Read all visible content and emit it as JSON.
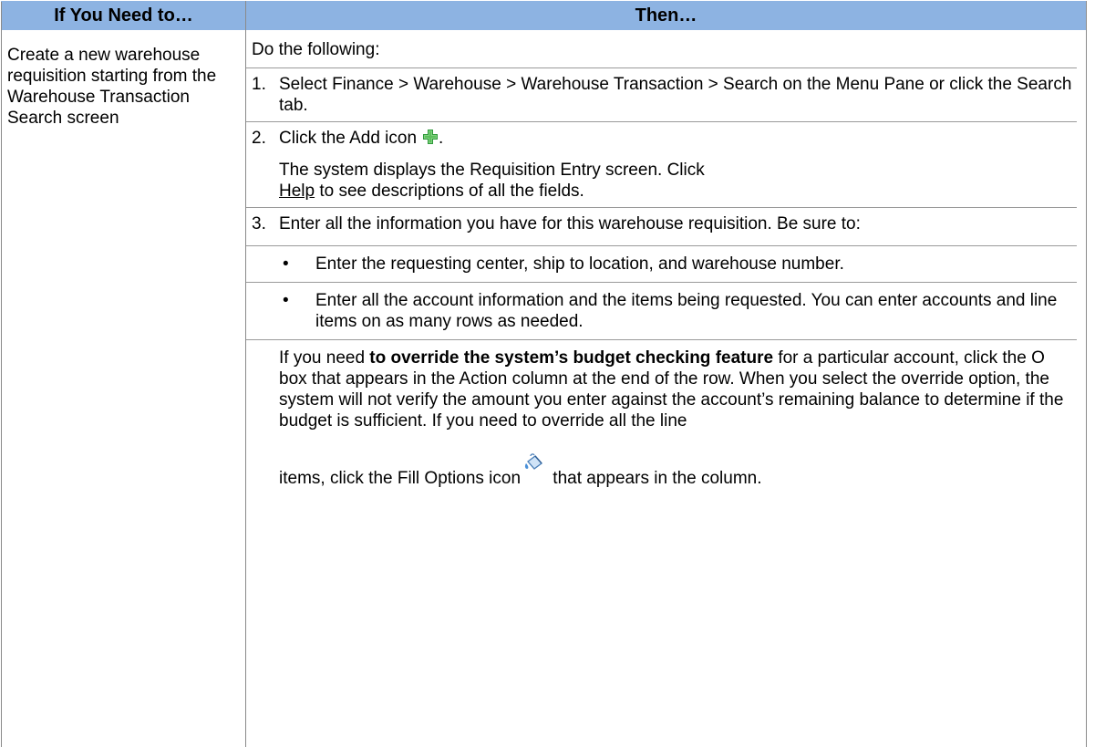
{
  "table": {
    "headers": [
      "If You Need to…",
      "Then…"
    ],
    "row1": {
      "condition": "Create a new warehouse requisition starting from the Warehouse Transaction Search screen",
      "intro": "Do the following:",
      "steps": [
        {
          "num": "1.",
          "text": "Select Finance > Warehouse > Warehouse Transaction > Search on the Menu Pane or click the Search tab."
        },
        {
          "num": "2.",
          "text_before_icon": "Click the Add icon",
          "text_after_icon": ".",
          "icon": "add-plus-icon",
          "note_before_link": "The system displays the Requisition Entry screen. Click",
          "note_link": "Help",
          "note_after_link": " to see descriptions of all the fields."
        },
        {
          "num": "3.",
          "text": "Enter all the information you have for this warehouse requisition. Be sure to:",
          "bullets": [
            "Enter the requesting center, ship to location, and warehouse number.",
            "Enter all the account information and the items being requested. You can enter accounts and line items on as many rows as needed."
          ],
          "override_prefix": "If you need ",
          "override_bold": "to override the system’s budget checking feature",
          "override_rest": " for a particular account, click the O box that appears in the Action column at the end of the row. When you select the override option, the system will not verify the amount you enter against the account’s remaining balance to determine if the budget is sufficient. If you need to override all the line",
          "override_line2_before_icon": "items, click the Fill Options icon",
          "override_icon": "fill-options-icon",
          "override_line2_after_icon": " that appears in the column."
        }
      ]
    }
  },
  "colors": {
    "header_bg": "#8db3e2",
    "add_icon": "#3cb043",
    "fill_icon": "#4a90d9"
  }
}
